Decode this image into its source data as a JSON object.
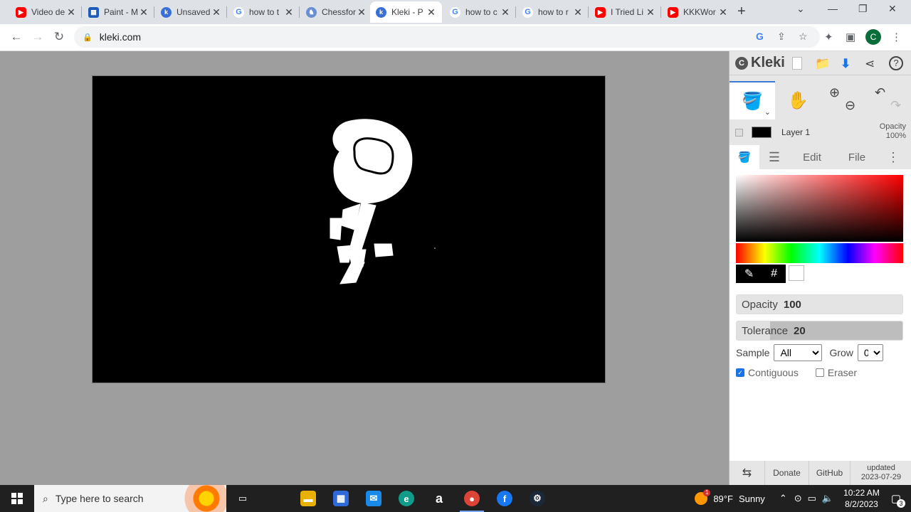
{
  "browser": {
    "tabs": [
      {
        "title": "Video de",
        "favicon": "youtube-icon",
        "active": false
      },
      {
        "title": "Paint - M",
        "favicon": "paint-icon",
        "active": false
      },
      {
        "title": "Unsaved",
        "favicon": "kleki-icon",
        "active": false
      },
      {
        "title": "how to t",
        "favicon": "google-icon",
        "active": false
      },
      {
        "title": "Chessfor",
        "favicon": "chess-icon",
        "active": false
      },
      {
        "title": "Kleki - P",
        "favicon": "kleki-icon",
        "active": true
      },
      {
        "title": "how to c",
        "favicon": "google-icon",
        "active": false
      },
      {
        "title": "how to r",
        "favicon": "google-icon",
        "active": false
      },
      {
        "title": "I Tried Li",
        "favicon": "youtube-icon",
        "active": false
      },
      {
        "title": "KKKWor",
        "favicon": "youtube-icon",
        "active": false
      }
    ],
    "url": "kleki.com",
    "profile_initial": "C"
  },
  "kleki": {
    "brand": "Kleki",
    "layer": {
      "name": "Layer 1",
      "opacity_label": "Opacity",
      "opacity_value": "100%"
    },
    "tabs": {
      "edit": "Edit",
      "file": "File"
    },
    "color_picker": {
      "hex_symbol": "#",
      "selected_color": "#ffffff"
    },
    "opacity": {
      "label": "Opacity",
      "value": "100",
      "fraction": 1.0
    },
    "tolerance": {
      "label": "Tolerance",
      "value": "20",
      "fraction": 0.2
    },
    "sample": {
      "label": "Sample",
      "selected": "All"
    },
    "grow": {
      "label": "Grow",
      "selected": "0"
    },
    "contiguous": {
      "label": "Contiguous",
      "checked": true
    },
    "eraser": {
      "label": "Eraser",
      "checked": false
    },
    "footer": {
      "donate": "Donate",
      "github": "GitHub",
      "updated_label": "updated",
      "updated_date": "2023-07-29"
    }
  },
  "taskbar": {
    "search_placeholder": "Type here to search",
    "weather_temp": "89°F",
    "weather_text": "Sunny",
    "time": "10:22 AM",
    "date": "8/2/2023",
    "notification_count": "3",
    "weather_badge": "1"
  },
  "colors": {
    "canvas_bg": "#000000",
    "workspace_bg": "#9e9e9e",
    "accent": "#1a73e8"
  }
}
